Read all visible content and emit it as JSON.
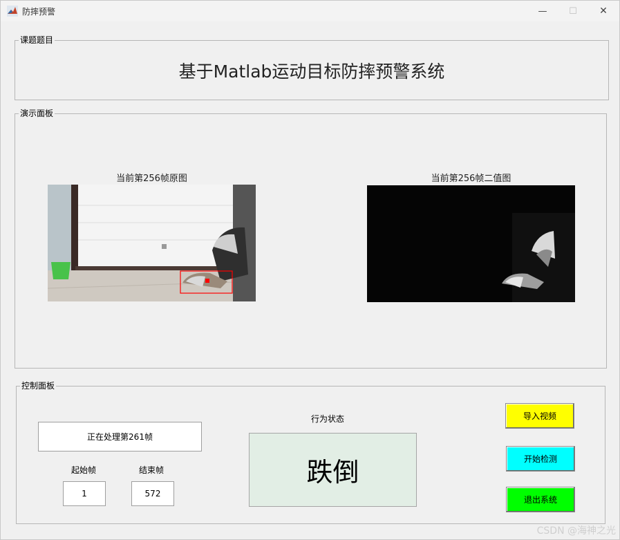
{
  "window": {
    "title": "防摔预警",
    "minimize": "—",
    "maximize": "☐",
    "close": "✕"
  },
  "topic_panel": {
    "legend": "课题题目",
    "heading": "基于Matlab运动目标防摔预警系统"
  },
  "demo_panel": {
    "legend": "演示面板",
    "original_caption": "当前第256帧原图",
    "binary_caption": "当前第256帧二值图"
  },
  "control_panel": {
    "legend": "控制面板",
    "processing_text": "正在处理第261帧",
    "start_frame_label": "起始帧",
    "start_frame_value": "1",
    "end_frame_label": "结束帧",
    "end_frame_value": "572",
    "status_label": "行为状态",
    "status_value": "跌倒",
    "import_button": "导入视频",
    "start_button": "开始检测",
    "exit_button": "退出系统"
  },
  "colors": {
    "import_button": "#ffff00",
    "start_button": "#00ffff",
    "exit_button": "#00ff00",
    "status_bg": "#e2eee5"
  },
  "watermark": "CSDN @海神之光"
}
